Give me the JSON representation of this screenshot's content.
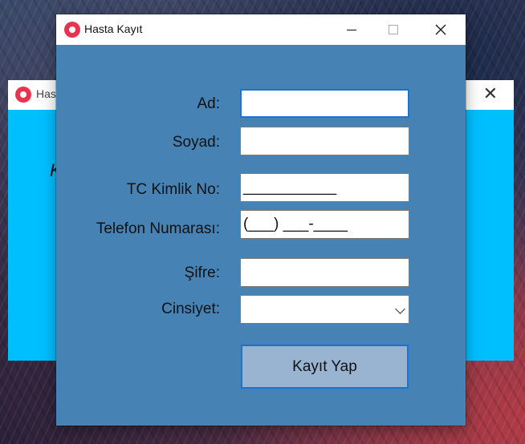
{
  "background_window": {
    "title": "Hasta",
    "heading_partial": "K"
  },
  "window": {
    "title": "Hasta Kayıt",
    "icon": "app-record-icon"
  },
  "form": {
    "ad_label": "Ad:",
    "ad_value": "",
    "soyad_label": "Soyad:",
    "soyad_value": "",
    "tc_label": "TC Kimlik No:",
    "tc_value": "___________",
    "telefon_label": "Telefon Numarası:",
    "telefon_value": "(___) ___-____",
    "sifre_label": "Şifre:",
    "sifre_value": "",
    "cinsiyet_label": "Cinsiyet:",
    "cinsiyet_value": ""
  },
  "submit_label": "Kayıt Yap",
  "colors": {
    "form_background": "#4682b4",
    "background_window": "#00bfff",
    "button": "#99b4d1",
    "focus_border": "#1e73d2"
  }
}
